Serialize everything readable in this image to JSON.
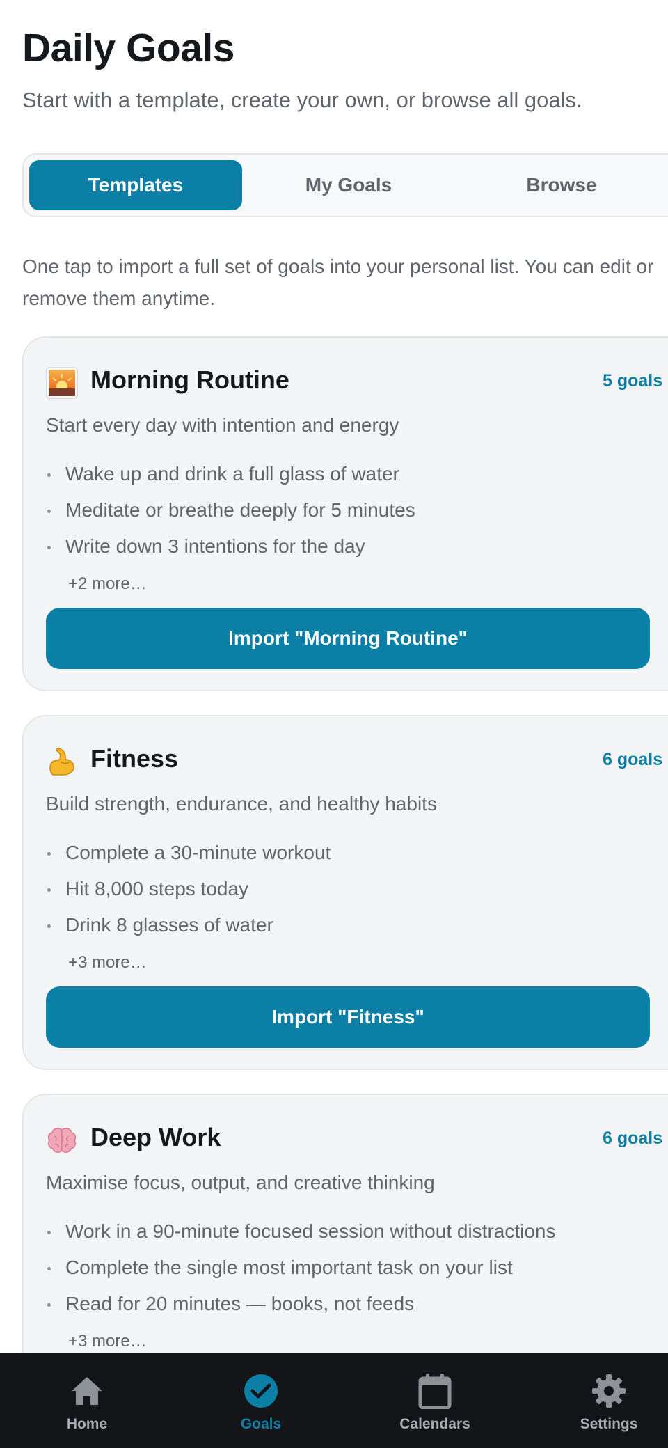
{
  "header": {
    "title": "Daily Goals",
    "subtitle": "Start with a template, create your own, or browse all goals."
  },
  "tabs": [
    {
      "label": "Templates",
      "selected": true
    },
    {
      "label": "My Goals",
      "selected": false
    },
    {
      "label": "Browse",
      "selected": false
    }
  ],
  "intro": "One tap to import a full set of goals into your personal list. You can edit or remove them anytime.",
  "templates": [
    {
      "icon": "sunrise-icon",
      "title": "Morning Routine",
      "count": "5 goals",
      "description": "Start every day with intention and energy",
      "goals": [
        "Wake up and drink a full glass of water",
        "Meditate or breathe deeply for 5 minutes",
        "Write down 3 intentions for the day"
      ],
      "more": "+2 more…",
      "import_label": "Import \"Morning Routine\""
    },
    {
      "icon": "flexed-biceps-icon",
      "title": "Fitness",
      "count": "6 goals",
      "description": "Build strength, endurance, and healthy habits",
      "goals": [
        "Complete a 30-minute workout",
        "Hit 8,000 steps today",
        "Drink 8 glasses of water"
      ],
      "more": "+3 more…",
      "import_label": "Import \"Fitness\""
    },
    {
      "icon": "brain-icon",
      "title": "Deep Work",
      "count": "6 goals",
      "description": "Maximise focus, output, and creative thinking",
      "goals": [
        "Work in a 90-minute focused session without distractions",
        "Complete the single most important task on your list",
        "Read for 20 minutes — books, not feeds"
      ],
      "more": "+3 more…"
    }
  ],
  "nav": [
    {
      "label": "Home",
      "icon": "home-icon",
      "active": false
    },
    {
      "label": "Goals",
      "icon": "check-circle-icon",
      "active": true
    },
    {
      "label": "Calendars",
      "icon": "calendar-icon",
      "active": false
    },
    {
      "label": "Settings",
      "icon": "gear-icon",
      "active": false
    }
  ],
  "colors": {
    "accent": "#0b7fa6",
    "nav_background": "#141519",
    "card_background": "#f3f4f5"
  }
}
